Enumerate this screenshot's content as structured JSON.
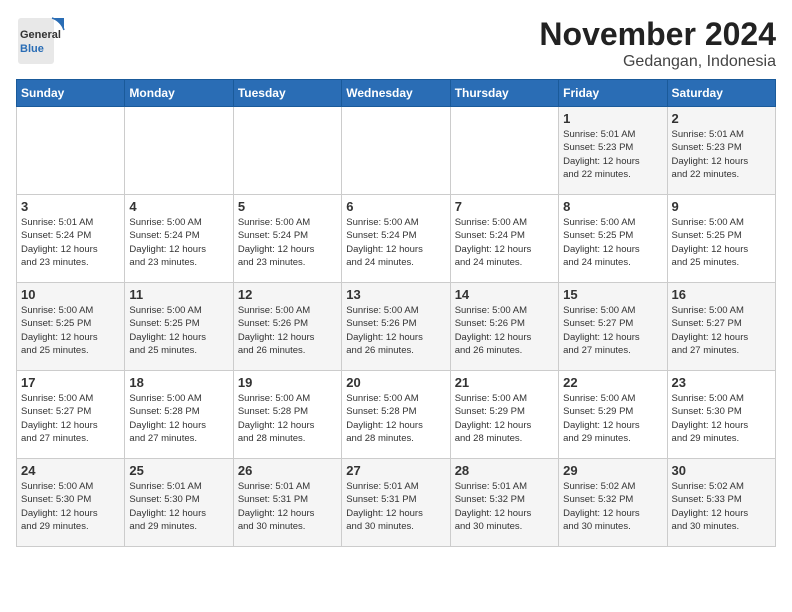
{
  "logo": {
    "general": "General",
    "blue": "Blue"
  },
  "title": "November 2024",
  "subtitle": "Gedangan, Indonesia",
  "days_of_week": [
    "Sunday",
    "Monday",
    "Tuesday",
    "Wednesday",
    "Thursday",
    "Friday",
    "Saturday"
  ],
  "weeks": [
    [
      {
        "day": "",
        "info": ""
      },
      {
        "day": "",
        "info": ""
      },
      {
        "day": "",
        "info": ""
      },
      {
        "day": "",
        "info": ""
      },
      {
        "day": "",
        "info": ""
      },
      {
        "day": "1",
        "info": "Sunrise: 5:01 AM\nSunset: 5:23 PM\nDaylight: 12 hours\nand 22 minutes."
      },
      {
        "day": "2",
        "info": "Sunrise: 5:01 AM\nSunset: 5:23 PM\nDaylight: 12 hours\nand 22 minutes."
      }
    ],
    [
      {
        "day": "3",
        "info": "Sunrise: 5:01 AM\nSunset: 5:24 PM\nDaylight: 12 hours\nand 23 minutes."
      },
      {
        "day": "4",
        "info": "Sunrise: 5:00 AM\nSunset: 5:24 PM\nDaylight: 12 hours\nand 23 minutes."
      },
      {
        "day": "5",
        "info": "Sunrise: 5:00 AM\nSunset: 5:24 PM\nDaylight: 12 hours\nand 23 minutes."
      },
      {
        "day": "6",
        "info": "Sunrise: 5:00 AM\nSunset: 5:24 PM\nDaylight: 12 hours\nand 24 minutes."
      },
      {
        "day": "7",
        "info": "Sunrise: 5:00 AM\nSunset: 5:24 PM\nDaylight: 12 hours\nand 24 minutes."
      },
      {
        "day": "8",
        "info": "Sunrise: 5:00 AM\nSunset: 5:25 PM\nDaylight: 12 hours\nand 24 minutes."
      },
      {
        "day": "9",
        "info": "Sunrise: 5:00 AM\nSunset: 5:25 PM\nDaylight: 12 hours\nand 25 minutes."
      }
    ],
    [
      {
        "day": "10",
        "info": "Sunrise: 5:00 AM\nSunset: 5:25 PM\nDaylight: 12 hours\nand 25 minutes."
      },
      {
        "day": "11",
        "info": "Sunrise: 5:00 AM\nSunset: 5:25 PM\nDaylight: 12 hours\nand 25 minutes."
      },
      {
        "day": "12",
        "info": "Sunrise: 5:00 AM\nSunset: 5:26 PM\nDaylight: 12 hours\nand 26 minutes."
      },
      {
        "day": "13",
        "info": "Sunrise: 5:00 AM\nSunset: 5:26 PM\nDaylight: 12 hours\nand 26 minutes."
      },
      {
        "day": "14",
        "info": "Sunrise: 5:00 AM\nSunset: 5:26 PM\nDaylight: 12 hours\nand 26 minutes."
      },
      {
        "day": "15",
        "info": "Sunrise: 5:00 AM\nSunset: 5:27 PM\nDaylight: 12 hours\nand 27 minutes."
      },
      {
        "day": "16",
        "info": "Sunrise: 5:00 AM\nSunset: 5:27 PM\nDaylight: 12 hours\nand 27 minutes."
      }
    ],
    [
      {
        "day": "17",
        "info": "Sunrise: 5:00 AM\nSunset: 5:27 PM\nDaylight: 12 hours\nand 27 minutes."
      },
      {
        "day": "18",
        "info": "Sunrise: 5:00 AM\nSunset: 5:28 PM\nDaylight: 12 hours\nand 27 minutes."
      },
      {
        "day": "19",
        "info": "Sunrise: 5:00 AM\nSunset: 5:28 PM\nDaylight: 12 hours\nand 28 minutes."
      },
      {
        "day": "20",
        "info": "Sunrise: 5:00 AM\nSunset: 5:28 PM\nDaylight: 12 hours\nand 28 minutes."
      },
      {
        "day": "21",
        "info": "Sunrise: 5:00 AM\nSunset: 5:29 PM\nDaylight: 12 hours\nand 28 minutes."
      },
      {
        "day": "22",
        "info": "Sunrise: 5:00 AM\nSunset: 5:29 PM\nDaylight: 12 hours\nand 29 minutes."
      },
      {
        "day": "23",
        "info": "Sunrise: 5:00 AM\nSunset: 5:30 PM\nDaylight: 12 hours\nand 29 minutes."
      }
    ],
    [
      {
        "day": "24",
        "info": "Sunrise: 5:00 AM\nSunset: 5:30 PM\nDaylight: 12 hours\nand 29 minutes."
      },
      {
        "day": "25",
        "info": "Sunrise: 5:01 AM\nSunset: 5:30 PM\nDaylight: 12 hours\nand 29 minutes."
      },
      {
        "day": "26",
        "info": "Sunrise: 5:01 AM\nSunset: 5:31 PM\nDaylight: 12 hours\nand 30 minutes."
      },
      {
        "day": "27",
        "info": "Sunrise: 5:01 AM\nSunset: 5:31 PM\nDaylight: 12 hours\nand 30 minutes."
      },
      {
        "day": "28",
        "info": "Sunrise: 5:01 AM\nSunset: 5:32 PM\nDaylight: 12 hours\nand 30 minutes."
      },
      {
        "day": "29",
        "info": "Sunrise: 5:02 AM\nSunset: 5:32 PM\nDaylight: 12 hours\nand 30 minutes."
      },
      {
        "day": "30",
        "info": "Sunrise: 5:02 AM\nSunset: 5:33 PM\nDaylight: 12 hours\nand 30 minutes."
      }
    ]
  ]
}
